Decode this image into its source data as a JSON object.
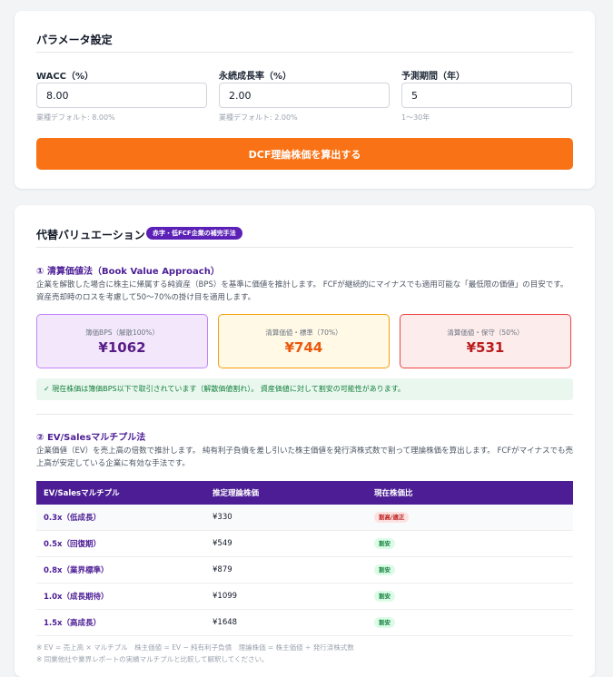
{
  "params": {
    "title": "パラメータ設定",
    "wacc": {
      "label": "WACC（%）",
      "value": "8.00",
      "hint": "業種デフォルト: 8.00%"
    },
    "growth": {
      "label": "永続成長率（%）",
      "value": "2.00",
      "hint": "業種デフォルト: 2.00%"
    },
    "period": {
      "label": "予測期間（年）",
      "value": "5",
      "hint": "1〜30年"
    },
    "button_label": "DCF理論株価を算出する"
  },
  "alt": {
    "title": "代替バリュエーション",
    "badge": "赤字・低FCF企業の補完手法",
    "book": {
      "heading": "① 清算価値法（Book Value Approach）",
      "desc": "企業を解散した場合に株主に帰属する純資産（BPS）を基準に価値を推計します。 FCFが継続的にマイナスでも適用可能な「最低限の価値」の目安です。 資産売却時のロスを考慮して50〜70%の掛け目を適用します。",
      "boxes": [
        {
          "label": "簿価BPS（解散100%）",
          "value": "¥1062"
        },
        {
          "label": "清算価値・標準（70%）",
          "value": "¥744"
        },
        {
          "label": "清算価値・保守（50%）",
          "value": "¥531"
        }
      ],
      "notice": "✓ 現在株価は簿価BPS以下で取引されています（解散価値割れ）。 資産価値に対して割安の可能性があります。"
    },
    "ev": {
      "heading": "② EV/Salesマルチプル法",
      "desc": "企業価値（EV）を売上高の倍数で推計します。 純有利子負債を差し引いた株主価値を発行済株式数で割って理論株価を算出します。 FCFがマイナスでも売上高が安定している企業に有効な手法です。",
      "headers": [
        "EV/Salesマルチプル",
        "推定理論株価",
        "現在株価比"
      ],
      "rows": [
        {
          "multiple": "0.3x（低成長）",
          "price": "¥330",
          "status": "割高/適正",
          "color": "#b91c1c"
        },
        {
          "multiple": "0.5x（回復期）",
          "price": "¥549",
          "status": "割安",
          "color": "#15803d"
        },
        {
          "multiple": "0.8x（業界標準）",
          "price": "¥879",
          "status": "割安",
          "color": "#15803d"
        },
        {
          "multiple": "1.0x（成長期待）",
          "price": "¥1099",
          "status": "割安",
          "color": "#15803d"
        },
        {
          "multiple": "1.5x（高成長）",
          "price": "¥1648",
          "status": "割安",
          "color": "#15803d"
        }
      ],
      "footnotes": [
        "※ EV = 売上高 × マルチプル　株主価値 = EV − 純有利子負債　理論株価 = 株主価値 ÷ 発行済株式数",
        "※ 同業他社や業界レポートの実績マルチプルと比較して解釈してください。"
      ]
    }
  }
}
